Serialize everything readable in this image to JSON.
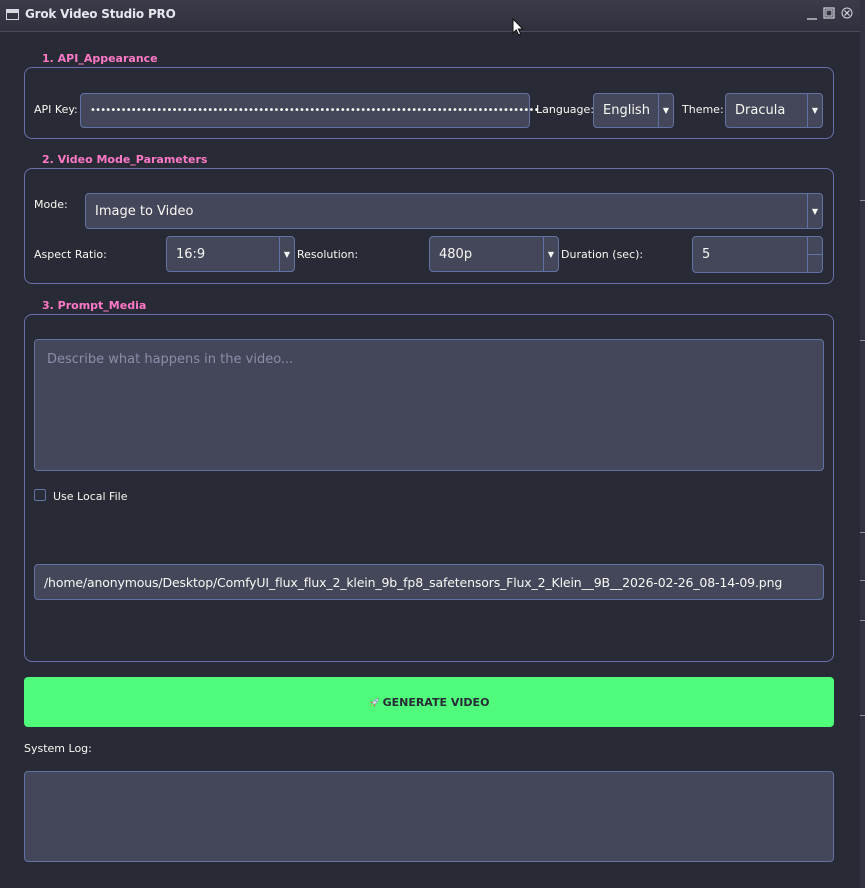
{
  "window": {
    "title": "Grok Video Studio PRO"
  },
  "api_group": {
    "title": "1. API_Appearance",
    "api_key_label": "API Key:",
    "api_key_value": "••••••••••••••••••••••••••••••••••••••••••••••••••••••••••••••••••••••••••••••••••••••••",
    "language_label": "Language:",
    "language_value": "English",
    "theme_label": "Theme:",
    "theme_value": "Dracula"
  },
  "video_group": {
    "title": "2. Video Mode_Parameters",
    "mode_label": "Mode:",
    "mode_value": "Image to Video",
    "aspect_label": "Aspect Ratio:",
    "aspect_value": "16:9",
    "resolution_label": "Resolution:",
    "resolution_value": "480p",
    "duration_label": "Duration (sec):",
    "duration_value": "5"
  },
  "prompt_group": {
    "title": "3. Prompt_Media",
    "prompt_placeholder": "Describe what happens in the video...",
    "prompt_value": "",
    "use_local_file_label": "Use Local File",
    "use_local_file_checked": false,
    "file_path_value": "/home/anonymous/Desktop/ComfyUI_flux_flux_2_klein_9b_fp8_safetensors_Flux_2_Klein__9B__2026-02-26_08-14-09.png"
  },
  "generate_button": {
    "icon": "rocket-icon",
    "label": "GENERATE VIDEO"
  },
  "log": {
    "label": "System Log:",
    "content": ""
  },
  "colors": {
    "accent_pink": "#ff79c6",
    "button_green": "#50fa7b",
    "background": "#282a36",
    "field_bg": "#44475a",
    "border": "#6272a4"
  }
}
